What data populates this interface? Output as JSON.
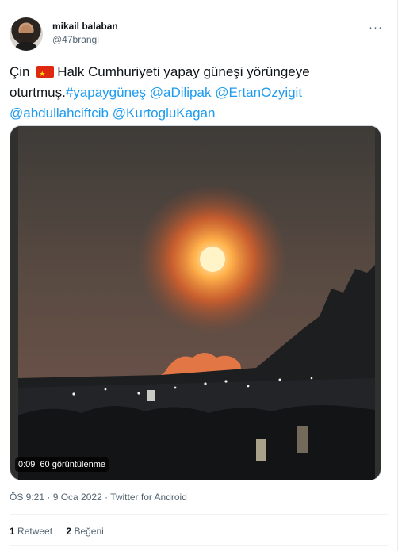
{
  "author": {
    "name": "mikail balaban",
    "handle": "@47brangi"
  },
  "menu": {
    "more_label": "···"
  },
  "tweet": {
    "text_before_flag": "Çin ",
    "text_after_flag": "Halk Cumhuriyeti yapay güneşi yörüngeye oturtmuş.",
    "hashtag": "#yapaygüneş",
    "mentions": [
      "@aDilipak",
      "@ErtanOzyigit",
      "@abdullahciftcib",
      "@KurtogluKagan"
    ]
  },
  "media": {
    "duration": "0:09",
    "views": "60 görüntülenme"
  },
  "meta": {
    "timestamp": "ÖS 9:21 · 9 Oca 2022 · Twitter for Android"
  },
  "stats": {
    "retweets_count": "1",
    "retweets_label": "Retweet",
    "likes_count": "2",
    "likes_label": "Beğeni"
  },
  "colors": {
    "accent": "#1d9bf0",
    "flag": "#de2910"
  },
  "icons": [
    "china-flag-icon",
    "more-options-icon"
  ]
}
